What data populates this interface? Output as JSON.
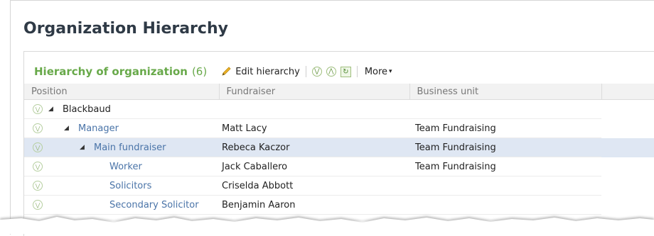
{
  "page": {
    "title": "Organization Hierarchy"
  },
  "toolbar": {
    "title": "Hierarchy of organization",
    "count": "(6)",
    "edit_label": "Edit hierarchy",
    "more_label": "More",
    "icons": [
      "pencil-icon",
      "expand-all-icon",
      "collapse-all-icon",
      "refresh-icon",
      "caret-down-icon"
    ]
  },
  "grid": {
    "columns": [
      "Position",
      "Fundraiser",
      "Business unit"
    ],
    "rows": [
      {
        "position": "Blackbaud",
        "fundraiser": "",
        "unit": "",
        "level": 0,
        "expandable": true,
        "link": false,
        "selected": false
      },
      {
        "position": "Manager",
        "fundraiser": "Matt Lacy",
        "unit": "Team Fundraising",
        "level": 1,
        "expandable": true,
        "link": true,
        "selected": false
      },
      {
        "position": "Main fundraiser",
        "fundraiser": "Rebeca Kaczor",
        "unit": "Team Fundraising",
        "level": 2,
        "expandable": true,
        "link": true,
        "selected": true
      },
      {
        "position": "Worker",
        "fundraiser": "Jack Caballero",
        "unit": "Team Fundraising",
        "level": 3,
        "expandable": false,
        "link": true,
        "selected": false
      },
      {
        "position": "Solicitors",
        "fundraiser": "Criselda Abbott",
        "unit": "",
        "level": 3,
        "expandable": false,
        "link": true,
        "selected": false
      },
      {
        "position": "Secondary Solicitor",
        "fundraiser": "Benjamin Aaron",
        "unit": "",
        "level": 3,
        "expandable": false,
        "link": true,
        "selected": false
      }
    ]
  },
  "colors": {
    "accent_green": "#68a94a",
    "link_blue": "#4a74a8",
    "selected_row": "#dfe7f3"
  }
}
